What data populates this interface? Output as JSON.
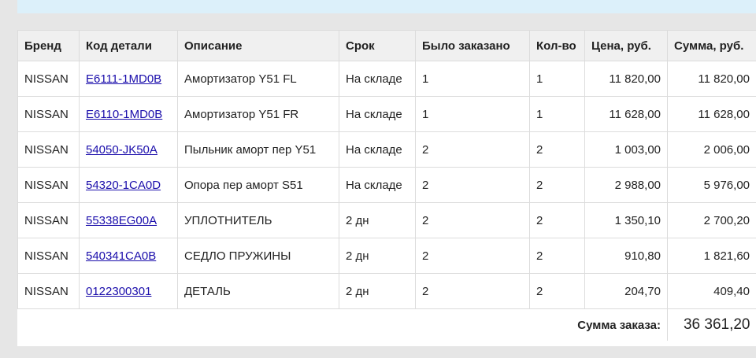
{
  "table": {
    "headers": {
      "brand": "Бренд",
      "code": "Код детали",
      "description": "Описание",
      "term": "Срок",
      "ordered": "Было заказано",
      "qty": "Кол-во",
      "price": "Цена, руб.",
      "sum": "Сумма, руб."
    },
    "rows": [
      {
        "brand": "NISSAN",
        "code": "E6111-1MD0B",
        "description": "Амортизатор Y51 FL",
        "term": "На складе",
        "ordered": "1",
        "qty": "1",
        "price": "11 820,00",
        "sum": "11 820,00"
      },
      {
        "brand": "NISSAN",
        "code": "E6110-1MD0B",
        "description": "Амортизатор Y51 FR",
        "term": "На складе",
        "ordered": "1",
        "qty": "1",
        "price": "11 628,00",
        "sum": "11 628,00"
      },
      {
        "brand": "NISSAN",
        "code": "54050-JK50A",
        "description": "Пыльник аморт пер Y51",
        "term": "На складе",
        "ordered": "2",
        "qty": "2",
        "price": "1 003,00",
        "sum": "2 006,00"
      },
      {
        "brand": "NISSAN",
        "code": "54320-1CA0D",
        "description": "Опора пер аморт S51",
        "term": "На складе",
        "ordered": "2",
        "qty": "2",
        "price": "2 988,00",
        "sum": "5 976,00"
      },
      {
        "brand": "NISSAN",
        "code": "55338EG00A",
        "description": "УПЛОТНИТЕЛЬ",
        "term": "2 дн",
        "ordered": "2",
        "qty": "2",
        "price": "1 350,10",
        "sum": "2 700,20"
      },
      {
        "brand": "NISSAN",
        "code": "540341CA0B",
        "description": "СЕДЛО ПРУЖИНЫ",
        "term": "2 дн",
        "ordered": "2",
        "qty": "2",
        "price": "910,80",
        "sum": "1 821,60"
      },
      {
        "brand": "NISSAN",
        "code": "0122300301",
        "description": "ДЕТАЛЬ",
        "term": "2 дн",
        "ordered": "2",
        "qty": "2",
        "price": "204,70",
        "sum": "409,40"
      }
    ],
    "total_label": "Сумма заказа:",
    "total_value": "36 361,20"
  }
}
